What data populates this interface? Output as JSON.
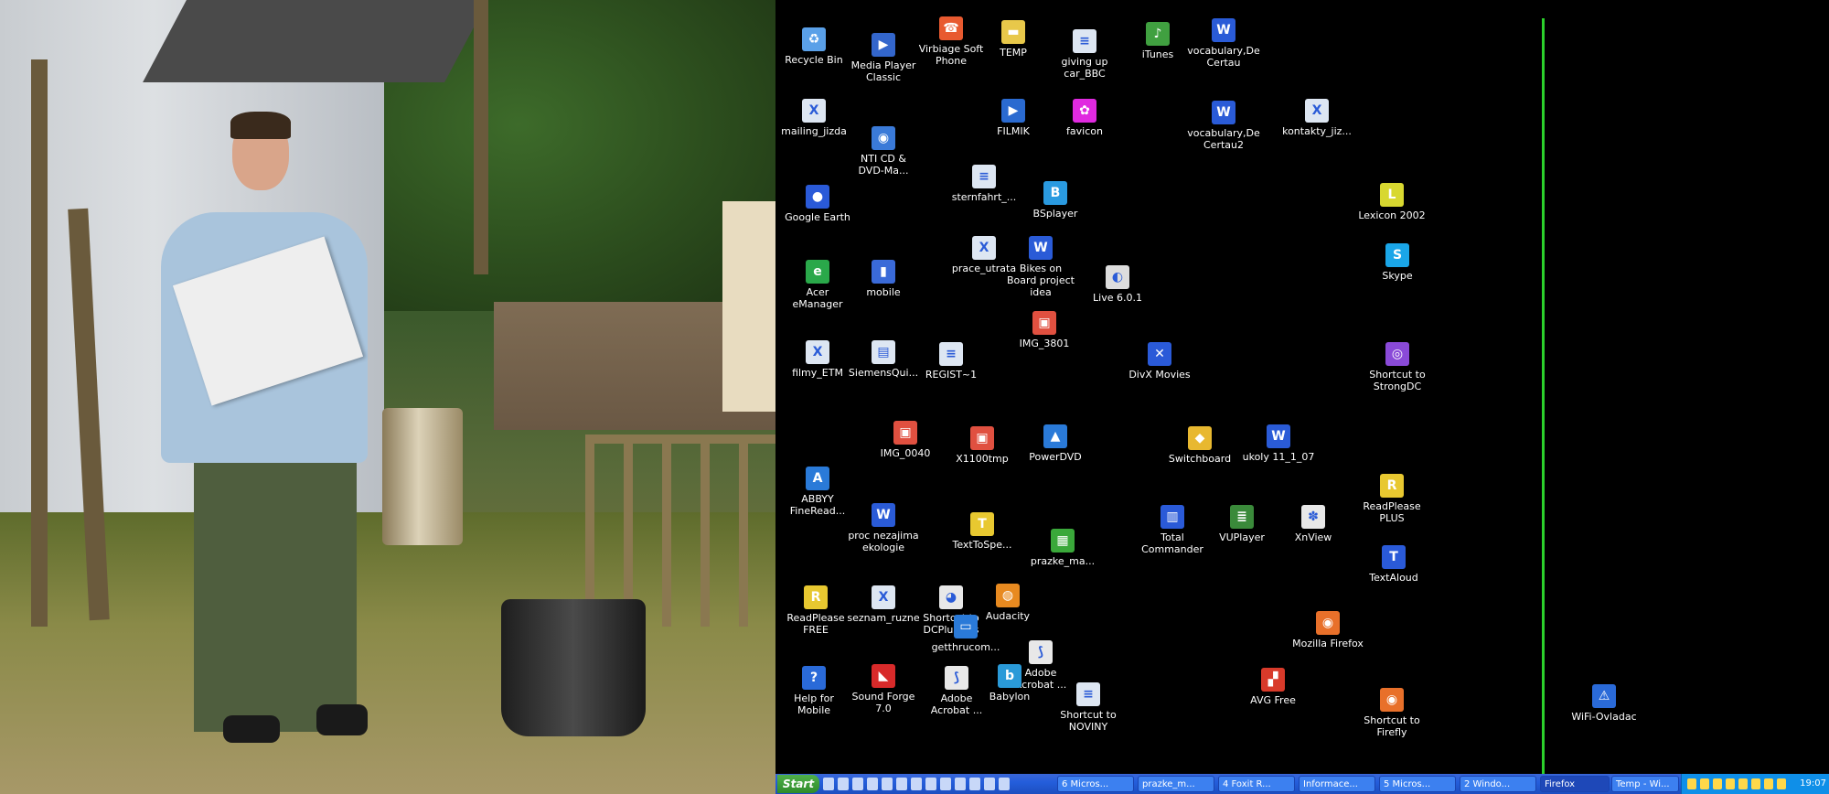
{
  "desktop": {
    "icons": [
      {
        "label": "Recycle Bin",
        "color": "#5aa0e8",
        "glyph": "♻"
      },
      {
        "label": "Media Player Classic",
        "color": "#3366cc",
        "glyph": "▶"
      },
      {
        "label": "Virbiage Soft Phone",
        "color": "#e85a30",
        "glyph": "☎"
      },
      {
        "label": "TEMP",
        "color": "#e8c84a",
        "glyph": "▬"
      },
      {
        "label": "giving up car_BBC",
        "color": "#dde6f2",
        "glyph": "≡"
      },
      {
        "label": "iTunes",
        "color": "#40a040",
        "glyph": "♪"
      },
      {
        "label": "vocabulary,De Certau",
        "color": "#2a5bd7",
        "glyph": "W"
      },
      {
        "label": "mailing_jizda",
        "color": "#dde6f2",
        "glyph": "X"
      },
      {
        "label": "NTI CD & DVD-Ma...",
        "color": "#3a7ad8",
        "glyph": "◉"
      },
      {
        "label": "FILMIK",
        "color": "#2a6ad0",
        "glyph": "▶"
      },
      {
        "label": "favicon",
        "color": "#e02ae0",
        "glyph": "✿"
      },
      {
        "label": "vocabulary,De Certau2",
        "color": "#2a5bd7",
        "glyph": "W"
      },
      {
        "label": "kontakty_jiz...",
        "color": "#dde6f2",
        "glyph": "X"
      },
      {
        "label": "sternfahrt_...",
        "color": "#dde6f2",
        "glyph": "≡"
      },
      {
        "label": "Google Earth",
        "color": "#2a5ad8",
        "glyph": "●"
      },
      {
        "label": "BSplayer",
        "color": "#2a9ae0",
        "glyph": "B"
      },
      {
        "label": "Lexicon 2002",
        "color": "#d8d830",
        "glyph": "L"
      },
      {
        "label": "Skype",
        "color": "#1aa6e8",
        "glyph": "S"
      },
      {
        "label": "prace_utrata",
        "color": "#dde6f2",
        "glyph": "X"
      },
      {
        "label": "Bikes on Board project idea",
        "color": "#2a5bd7",
        "glyph": "W"
      },
      {
        "label": "Acer eManager",
        "color": "#2aa84a",
        "glyph": "e"
      },
      {
        "label": "mobile",
        "color": "#3a6ad8",
        "glyph": "▮"
      },
      {
        "label": "Live 6.0.1",
        "color": "#dddddd",
        "glyph": "◐"
      },
      {
        "label": "IMG_3801",
        "color": "#e05040",
        "glyph": "▣"
      },
      {
        "label": "filmy_ETM",
        "color": "#dde6f2",
        "glyph": "X"
      },
      {
        "label": "SiemensQui...",
        "color": "#dde6f2",
        "glyph": "▤"
      },
      {
        "label": "REGIST~1",
        "color": "#dde6f2",
        "glyph": "≡"
      },
      {
        "label": "DivX Movies",
        "color": "#2a5ad8",
        "glyph": "✕"
      },
      {
        "label": "Shortcut to StrongDC",
        "color": "#8a4ad8",
        "glyph": "◎"
      },
      {
        "label": "IMG_0040",
        "color": "#e05040",
        "glyph": "▣"
      },
      {
        "label": "X1100tmp",
        "color": "#e05040",
        "glyph": "▣"
      },
      {
        "label": "PowerDVD",
        "color": "#2a7ad8",
        "glyph": "▲"
      },
      {
        "label": "Switchboard",
        "color": "#e8b830",
        "glyph": "◆"
      },
      {
        "label": "ukoly 11_1_07",
        "color": "#2a5bd7",
        "glyph": "W"
      },
      {
        "label": "ABBYY FineRead...",
        "color": "#2a7ad8",
        "glyph": "A"
      },
      {
        "label": "proc nezajima ekologie",
        "color": "#2a5bd7",
        "glyph": "W"
      },
      {
        "label": "TextToSpe...",
        "color": "#e8c830",
        "glyph": "T"
      },
      {
        "label": "prazke_ma...",
        "color": "#3aa83a",
        "glyph": "▦"
      },
      {
        "label": "Total Commander",
        "color": "#2a5ad8",
        "glyph": "▥"
      },
      {
        "label": "VUPlayer",
        "color": "#3a8a3a",
        "glyph": "≣"
      },
      {
        "label": "XnView",
        "color": "#e8e8e8",
        "glyph": "✽"
      },
      {
        "label": "ReadPlease PLUS",
        "color": "#e8c830",
        "glyph": "R"
      },
      {
        "label": "TextAloud",
        "color": "#2a5ad8",
        "glyph": "T"
      },
      {
        "label": "ReadPlease FREE",
        "color": "#e8c830",
        "glyph": "R"
      },
      {
        "label": "seznam_ruzne",
        "color": "#dde6f2",
        "glyph": "X"
      },
      {
        "label": "Shortcut to DCPlusPlus",
        "color": "#e8e8e8",
        "glyph": "◕"
      },
      {
        "label": "Audacity",
        "color": "#e88a20",
        "glyph": "◍"
      },
      {
        "label": "getthrucom...",
        "color": "#2a7ad8",
        "glyph": "▭"
      },
      {
        "label": "Mozilla Firefox",
        "color": "#e8702a",
        "glyph": "◉"
      },
      {
        "label": "Adobe Acrobat ...",
        "color": "#e8e8e8",
        "glyph": "⟆"
      },
      {
        "label": "Help for Mobile",
        "color": "#2a6ad8",
        "glyph": "?"
      },
      {
        "label": "Sound Forge 7.0",
        "color": "#d82a2a",
        "glyph": "◣"
      },
      {
        "label": "Adobe Acrobat ...",
        "color": "#e8e8e8",
        "glyph": "⟆"
      },
      {
        "label": "Babylon",
        "color": "#2a9ad8",
        "glyph": "b"
      },
      {
        "label": "Shortcut to NOVINY",
        "color": "#dde6f2",
        "glyph": "≡"
      },
      {
        "label": "AVG Free",
        "color": "#d83a2a",
        "glyph": "▞"
      },
      {
        "label": "Shortcut to Firefly",
        "color": "#e8702a",
        "glyph": "◉"
      },
      {
        "label": "WiFi-Ovladac",
        "color": "#2a6ad8",
        "glyph": "⚠"
      }
    ]
  },
  "taskbar": {
    "start_label": "Start",
    "tasks": [
      {
        "label": "6 Micros..."
      },
      {
        "label": "prazke_m..."
      },
      {
        "label": "4 Foxit R..."
      },
      {
        "label": "Informace..."
      },
      {
        "label": "5 Micros..."
      },
      {
        "label": "2 Windo..."
      },
      {
        "label": "Firefox"
      },
      {
        "label": "Temp - Wi..."
      }
    ],
    "clock": "19:07"
  }
}
